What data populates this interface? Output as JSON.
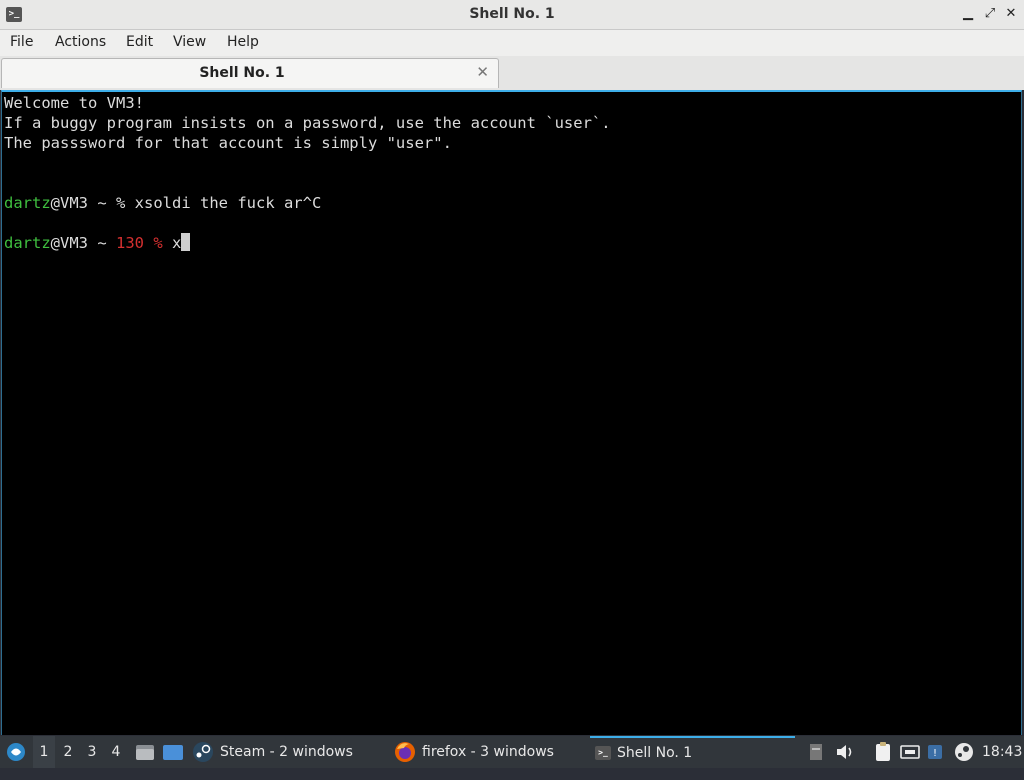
{
  "window": {
    "title": "Shell No. 1",
    "controls": {
      "minimize": "▁",
      "maximize": "⤢",
      "close": "✕"
    }
  },
  "menu": [
    "File",
    "Actions",
    "Edit",
    "View",
    "Help"
  ],
  "tab": {
    "label": "Shell No. 1",
    "close": "✕"
  },
  "terminal": {
    "lines": [
      "Welcome to VM3!",
      "If a buggy program insists on a password, use the account `user`.",
      "The passsword for that account is simply \"user\"."
    ],
    "prompt1": {
      "user": "dartz",
      "host": "@VM3 ~ % ",
      "command": "xsoldi the fuck ar^C"
    },
    "prompt2": {
      "user": "dartz",
      "host": "@VM3 ~ ",
      "status": "130 %",
      "command": " x"
    }
  },
  "taskbar": {
    "workspaces": [
      "1",
      "2",
      "3",
      "4"
    ],
    "tasks": [
      {
        "label": "Steam - 2 windows"
      },
      {
        "label": "firefox - 3 windows"
      },
      {
        "label": "Shell No. 1"
      }
    ],
    "clock": "18:43",
    "colors": {
      "accent": "#3daee9",
      "panel": "#31363b"
    }
  }
}
